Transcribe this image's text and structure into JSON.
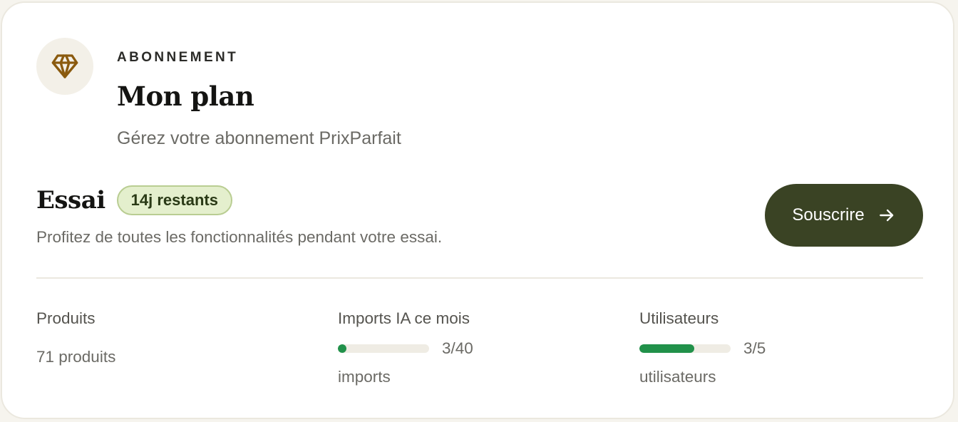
{
  "header": {
    "icon": "diamond-icon",
    "eyebrow": "ABONNEMENT",
    "title": "Mon plan",
    "subtitle": "Gérez votre abonnement PrixParfait"
  },
  "plan": {
    "name": "Essai",
    "badge": "14j restants",
    "description": "Profitez de toutes les fonctionnalités pendant votre essai.",
    "cta_label": "Souscrire",
    "cta_icon": "arrow-right-icon"
  },
  "stats": {
    "products": {
      "label": "Produits",
      "value": "71 produits"
    },
    "ai_imports": {
      "label": "Imports IA ce mois",
      "used": 3,
      "limit": 40,
      "count_text": "3/40",
      "unit": "imports"
    },
    "users": {
      "label": "Utilisateurs",
      "used": 3,
      "limit": 5,
      "count_text": "3/5",
      "unit": "utilisateurs"
    }
  },
  "colors": {
    "accent_dark": "#3a4324",
    "progress": "#21914a",
    "badge_bg": "#e4efcd",
    "badge_border": "#b9cd92",
    "icon_gold": "#8a5a0e"
  }
}
